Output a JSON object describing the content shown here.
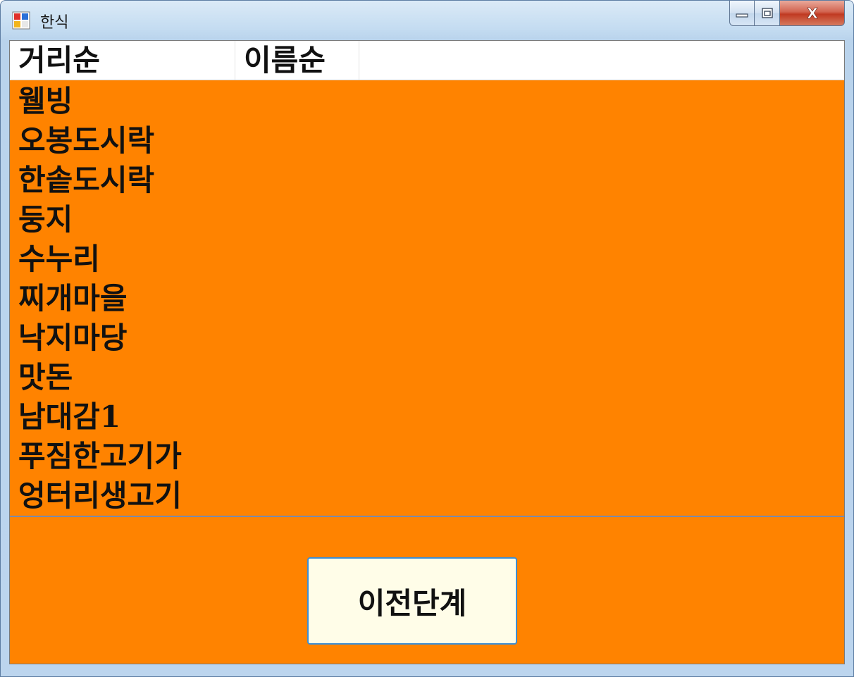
{
  "window": {
    "title": "한식",
    "app_icon": "winforms-app-icon",
    "controls": {
      "minimize_icon": "minimize-icon",
      "maximize_icon": "maximize-icon",
      "close_icon": "close-icon",
      "close_glyph": "X"
    }
  },
  "list": {
    "columns": [
      "거리순",
      "이름순"
    ],
    "items": [
      "웰빙",
      "오봉도시락",
      "한솥도시락",
      "둥지",
      "수누리",
      "찌개마을",
      "낙지마당",
      "맛돈",
      "남대감1",
      "푸짐한고기가",
      "엉터리생고기"
    ]
  },
  "buttons": {
    "previous_step": "이전단계"
  },
  "colors": {
    "background": "#ff8300",
    "button_fill": "#fffde8",
    "button_border": "#3c8fd6",
    "close_button": "#c8432b"
  }
}
